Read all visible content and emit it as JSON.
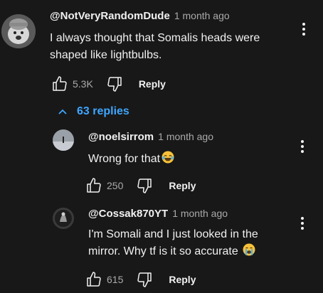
{
  "main_comment": {
    "author": "@NotVeryRandomDude",
    "time": "1 month ago",
    "text_line1": "I always thought that Somalis heads were",
    "text_line2": "shaped like lightbulbs.",
    "likes": "5.3K",
    "reply_label": "Reply"
  },
  "replies_toggle": {
    "label": "63 replies"
  },
  "replies": [
    {
      "author": "@noelsirrom",
      "time": "1 month ago",
      "text_line1": "Wrong for that",
      "likes": "250",
      "reply_label": "Reply",
      "emoji": "joy-emoji"
    },
    {
      "author": "@Cossak870YT",
      "time": "1 month ago",
      "text_line1": "I'm Somali and I just looked in the",
      "text_line2": "mirror. Why tf is it so accurate",
      "likes": "615",
      "reply_label": "Reply",
      "emoji": "crying-emoji"
    }
  ],
  "colors": {
    "background": "#181818",
    "text": "#f1f1f1",
    "muted": "#aaaaaa",
    "link": "#3ea6ff"
  }
}
